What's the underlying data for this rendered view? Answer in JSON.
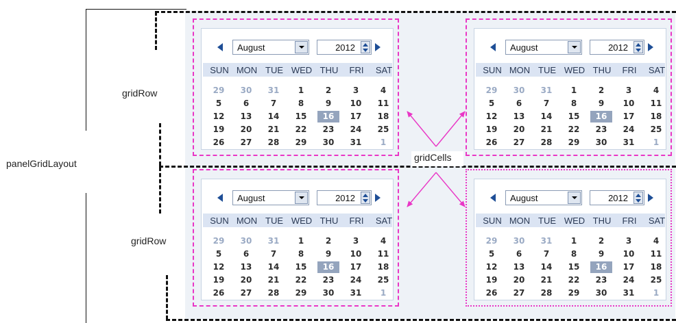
{
  "labels": {
    "panel_grid_layout": "panelGridLayout",
    "grid_row_top": "gridRow",
    "grid_row_bottom": "gridRow",
    "grid_cells": "gridCells"
  },
  "colors": {
    "cell_border": "#e936c6",
    "arrow": "#e936c6",
    "row_dash": "#111111",
    "selected_day_bg": "#94a4bd",
    "weekday_header_bg": "#dbe4f3",
    "nav_arrow": "#1e4e96"
  },
  "calendar": {
    "month": "August",
    "year": "2012",
    "selected_day": "16",
    "weekdays": [
      "SUN",
      "MON",
      "TUE",
      "WED",
      "THU",
      "FRI",
      "SAT"
    ],
    "weeks": [
      [
        "29",
        "30",
        "31",
        "1",
        "2",
        "3",
        "4"
      ],
      [
        "5",
        "6",
        "7",
        "8",
        "9",
        "10",
        "11"
      ],
      [
        "12",
        "13",
        "14",
        "15",
        "16",
        "17",
        "18"
      ],
      [
        "19",
        "20",
        "21",
        "22",
        "23",
        "24",
        "25"
      ],
      [
        "26",
        "27",
        "28",
        "29",
        "30",
        "31",
        "1"
      ]
    ],
    "muted_days": [
      [
        0,
        0
      ],
      [
        0,
        1
      ],
      [
        0,
        2
      ],
      [
        4,
        6
      ]
    ],
    "icons": {
      "prev": "triangle-left-icon",
      "next": "triangle-right-icon",
      "dropdown": "chevron-down-icon",
      "spinner": "spinner-up-down-icon"
    }
  }
}
